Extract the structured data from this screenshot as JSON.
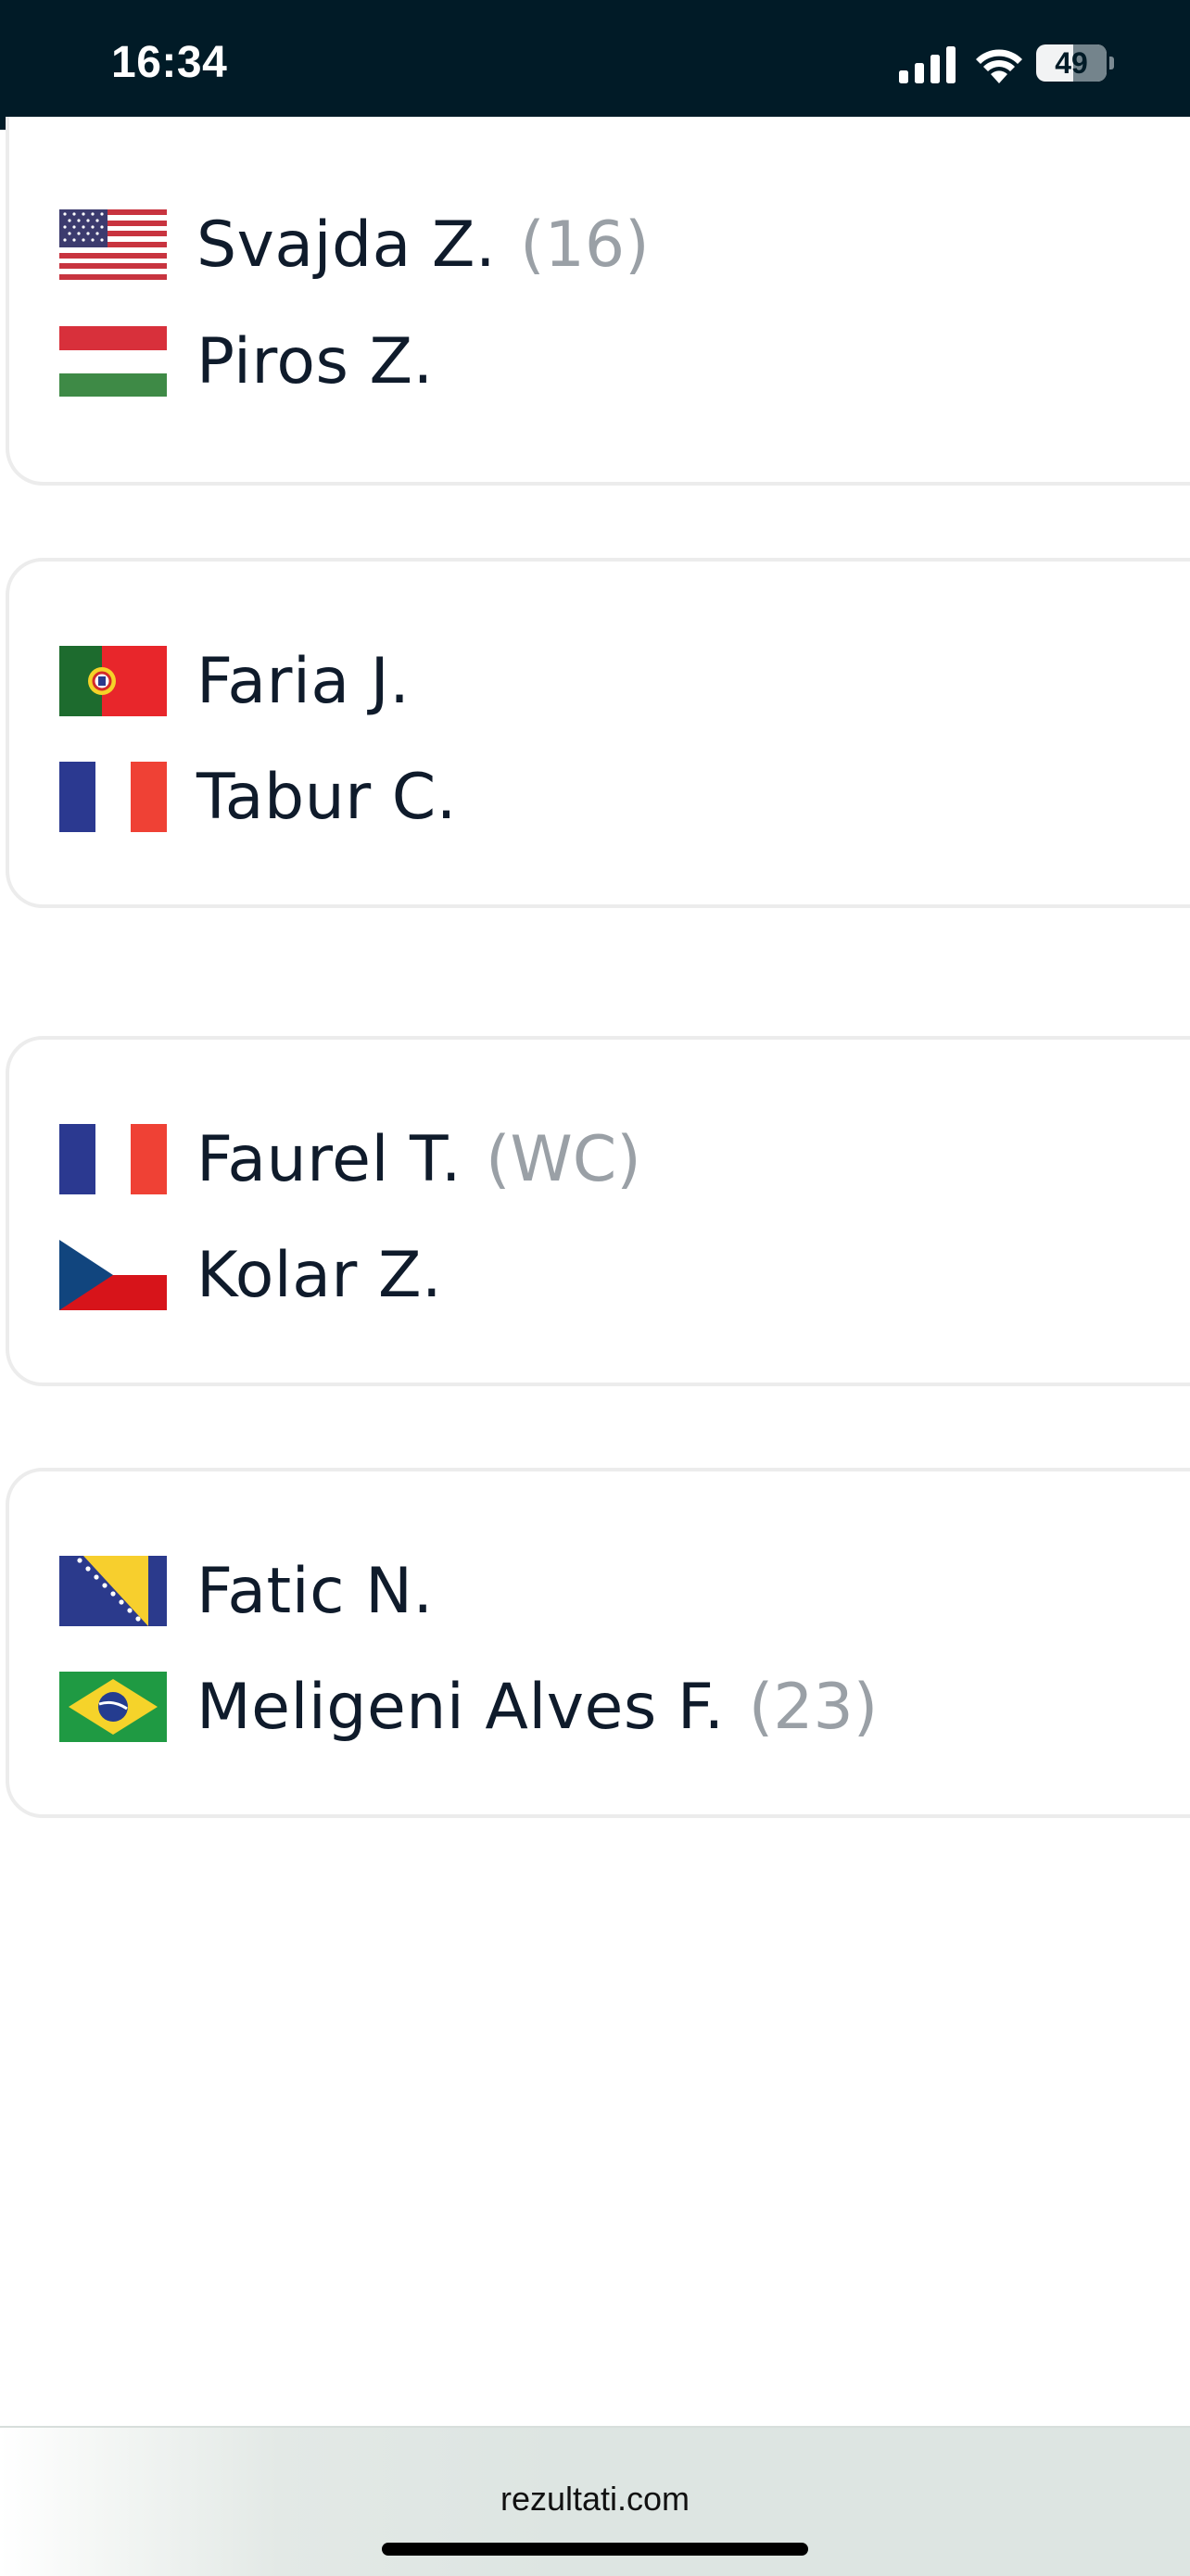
{
  "status_bar": {
    "time": "16:34",
    "battery_level": "49",
    "icons": [
      "signal-icon",
      "wifi-icon",
      "battery-icon"
    ]
  },
  "matches": [
    {
      "players": [
        {
          "name": "Svajda Z.",
          "seed": "(16)",
          "flag": "usa-flag-icon"
        },
        {
          "name": "Piros Z.",
          "seed": "",
          "flag": "hungary-flag-icon"
        }
      ]
    },
    {
      "players": [
        {
          "name": "Faria J.",
          "seed": "",
          "flag": "portugal-flag-icon"
        },
        {
          "name": "Tabur C.",
          "seed": "",
          "flag": "france-flag-icon"
        }
      ]
    },
    {
      "players": [
        {
          "name": "Faurel T.",
          "seed": "(WC)",
          "flag": "france-flag-icon"
        },
        {
          "name": "Kolar Z.",
          "seed": "",
          "flag": "czech-flag-icon"
        }
      ]
    },
    {
      "players": [
        {
          "name": "Fatic N.",
          "seed": "",
          "flag": "bosnia-flag-icon"
        },
        {
          "name": "Meligeni Alves F.",
          "seed": "(23)",
          "flag": "brazil-flag-icon"
        }
      ]
    }
  ],
  "browser": {
    "url": "rezultati.com"
  },
  "colors": {
    "status_bar_bg": "#011b27",
    "text_primary": "#0f1b2b",
    "text_seed": "#9aa0a6",
    "card_border": "#ececec"
  }
}
